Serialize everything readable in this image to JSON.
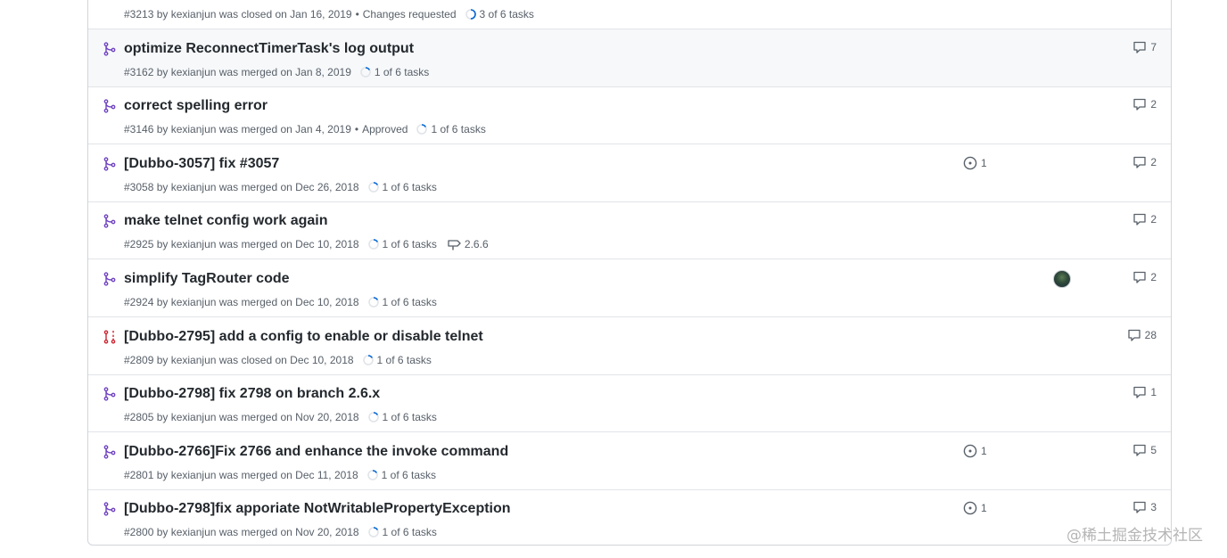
{
  "colors": {
    "merged": "#6f42c1",
    "closed": "#cb2431",
    "meta": "#586069",
    "title": "#24292e"
  },
  "pull_requests": [
    {
      "state": "closed",
      "title": "",
      "number": "#3213",
      "author": "kexianjun",
      "action": "was closed on",
      "date": "Jan 16, 2019",
      "review": "Changes requested",
      "tasks": "3 of 6 tasks",
      "task_progress": 0.5,
      "comments": "",
      "linked_issues": "",
      "milestone": ""
    },
    {
      "state": "merged",
      "title": "optimize ReconnectTimerTask's log output",
      "number": "#3162",
      "author": "kexianjun",
      "action": "was merged on",
      "date": "Jan 8, 2019",
      "review": "",
      "tasks": "1 of 6 tasks",
      "task_progress": 0.1667,
      "comments": "7",
      "linked_issues": "",
      "milestone": ""
    },
    {
      "state": "merged",
      "title": "correct spelling error",
      "number": "#3146",
      "author": "kexianjun",
      "action": "was merged on",
      "date": "Jan 4, 2019",
      "review": "Approved",
      "tasks": "1 of 6 tasks",
      "task_progress": 0.1667,
      "comments": "2",
      "linked_issues": "",
      "milestone": ""
    },
    {
      "state": "merged",
      "title": "[Dubbo-3057] fix #3057",
      "number": "#3058",
      "author": "kexianjun",
      "action": "was merged on",
      "date": "Dec 26, 2018",
      "review": "",
      "tasks": "1 of 6 tasks",
      "task_progress": 0.1667,
      "comments": "2",
      "linked_issues": "1",
      "milestone": ""
    },
    {
      "state": "merged",
      "title": "make telnet config work again",
      "number": "#2925",
      "author": "kexianjun",
      "action": "was merged on",
      "date": "Dec 10, 2018",
      "review": "",
      "tasks": "1 of 6 tasks",
      "task_progress": 0.1667,
      "comments": "2",
      "linked_issues": "",
      "milestone": "2.6.6"
    },
    {
      "state": "merged",
      "title": "simplify TagRouter code",
      "number": "#2924",
      "author": "kexianjun",
      "action": "was merged on",
      "date": "Dec 10, 2018",
      "review": "",
      "tasks": "1 of 6 tasks",
      "task_progress": 0.1667,
      "comments": "2",
      "linked_issues": "",
      "milestone": "",
      "has_assignee": true
    },
    {
      "state": "closed",
      "title": "[Dubbo-2795] add a config to enable or disable telnet",
      "number": "#2809",
      "author": "kexianjun",
      "action": "was closed on",
      "date": "Dec 10, 2018",
      "review": "",
      "tasks": "1 of 6 tasks",
      "task_progress": 0.1667,
      "comments": "28",
      "linked_issues": "",
      "milestone": ""
    },
    {
      "state": "merged",
      "title": "[Dubbo-2798] fix 2798 on branch 2.6.x",
      "number": "#2805",
      "author": "kexianjun",
      "action": "was merged on",
      "date": "Nov 20, 2018",
      "review": "",
      "tasks": "1 of 6 tasks",
      "task_progress": 0.1667,
      "comments": "1",
      "linked_issues": "",
      "milestone": ""
    },
    {
      "state": "merged",
      "title": "[Dubbo-2766]Fix 2766 and enhance the invoke command",
      "number": "#2801",
      "author": "kexianjun",
      "action": "was merged on",
      "date": "Dec 11, 2018",
      "review": "",
      "tasks": "1 of 6 tasks",
      "task_progress": 0.1667,
      "comments": "5",
      "linked_issues": "1",
      "milestone": ""
    },
    {
      "state": "merged",
      "title": "[Dubbo-2798]fix apporiate NotWritablePropertyException",
      "number": "#2800",
      "author": "kexianjun",
      "action": "was merged on",
      "date": "Nov 20, 2018",
      "review": "",
      "tasks": "1 of 6 tasks",
      "task_progress": 0.1667,
      "comments": "3",
      "linked_issues": "1",
      "milestone": ""
    }
  ],
  "watermark": "@稀土掘金技术社区"
}
